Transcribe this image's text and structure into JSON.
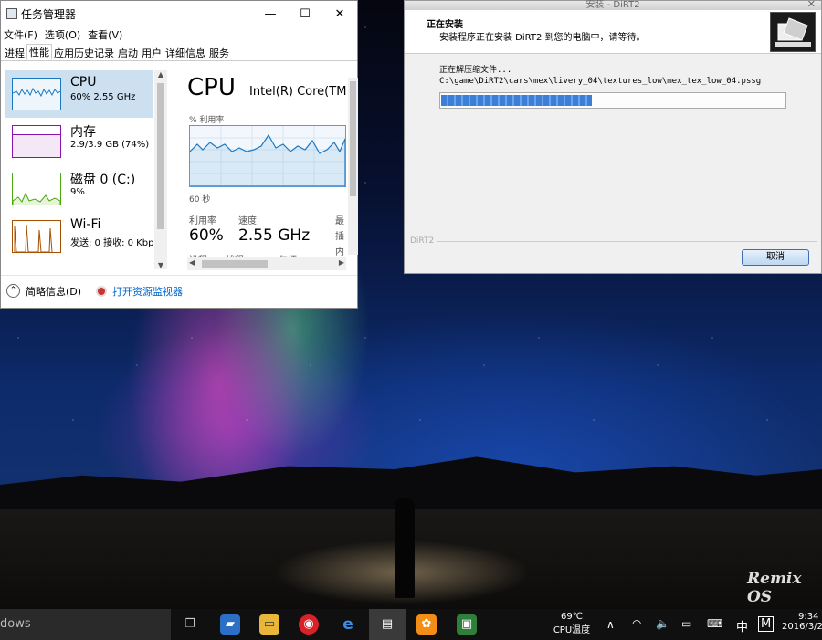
{
  "task_manager": {
    "title": "任务管理器",
    "menu": [
      "文件(F)",
      "选项(O)",
      "查看(V)"
    ],
    "tabs": [
      "进程",
      "性能",
      "应用历史记录",
      "启动",
      "用户",
      "详细信息",
      "服务"
    ],
    "active_tab": "性能",
    "resources": [
      {
        "name": "CPU",
        "sub": "60%  2.55 GHz",
        "color": "#1a78c2"
      },
      {
        "name": "内存",
        "sub": "2.9/3.9 GB (74%)",
        "color": "#8b12ae"
      },
      {
        "name": "磁盘 0 (C:)",
        "sub": "9%",
        "color": "#4da60c"
      },
      {
        "name": "Wi-Fi",
        "sub": "发送: 0 接收: 0 Kbp",
        "color": "#a74f01"
      }
    ],
    "detail": {
      "title": "CPU",
      "processor": "Intel(R) Core(TM",
      "util_label": "% 利用率",
      "time_label": "60 秒",
      "util_rate_label": "利用率",
      "util_rate_value": "60%",
      "speed_label": "速度",
      "speed_value": "2.55 GHz",
      "max_label": "最",
      "socket_label": "插",
      "cores_label": "内",
      "processes_label": "进程",
      "threads_label": "线程",
      "handles_label": "句柄"
    },
    "footer": {
      "summary": "简略信息(D)",
      "monitor_link": "打开资源监视器"
    }
  },
  "installer": {
    "window_title": "安装 - DiRT2",
    "heading": "正在安装",
    "subheading": "安装程序正在安装 DiRT2 到您的电脑中，请等待。",
    "status": "正在解压缩文件...",
    "path": "C:\\game\\DiRT2\\cars\\mex\\livery_04\\textures_low\\mex_tex_low_04.pssg",
    "progress": 0.44,
    "brand": "DiRT2",
    "cancel_label": "取消"
  },
  "desktop": {
    "watermark": "Remix OS"
  },
  "taskbar": {
    "search_text": "dows",
    "temperature": "69℃",
    "temp_label": "CPU温度",
    "ime": "中",
    "ime_mode": "M",
    "time": "9:34",
    "date": "2016/3/2"
  }
}
